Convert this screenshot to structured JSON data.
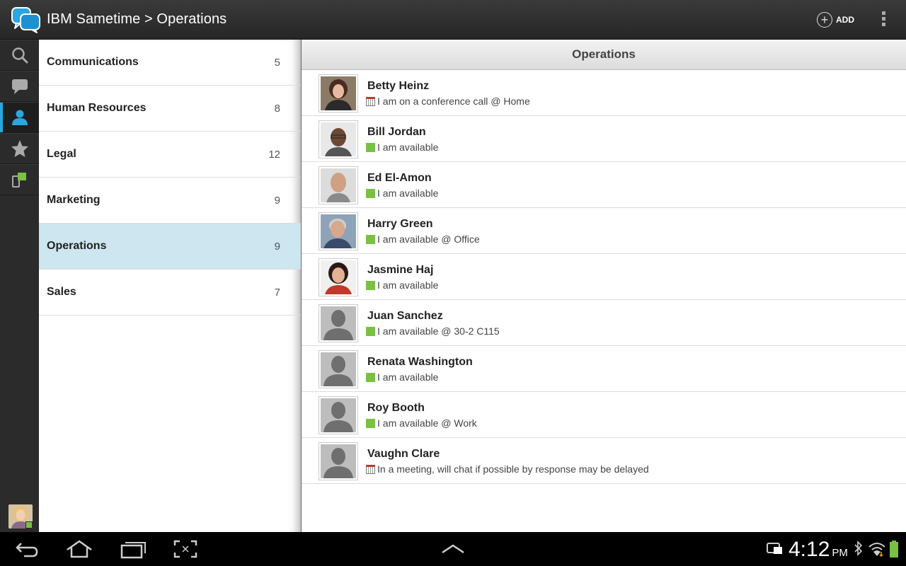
{
  "header": {
    "title": "IBM Sametime > Operations",
    "add_label": "ADD"
  },
  "rail": {
    "items": [
      "search-icon",
      "chat-icon",
      "contacts-icon",
      "favorites-icon",
      "devices-icon"
    ],
    "active": "contacts-icon",
    "accent": "#29a7e0"
  },
  "groups": [
    {
      "name": "Communications",
      "count": "5"
    },
    {
      "name": "Human Resources",
      "count": "8"
    },
    {
      "name": "Legal",
      "count": "12"
    },
    {
      "name": "Marketing",
      "count": "9"
    },
    {
      "name": "Operations",
      "count": "9",
      "selected": true
    },
    {
      "name": "Sales",
      "count": "7"
    }
  ],
  "detail": {
    "title": "Operations",
    "contacts": [
      {
        "name": "Betty Heinz",
        "status": "I am on a conference call @ Home",
        "state": "meeting",
        "photo": "woman-dark-hair"
      },
      {
        "name": "Bill Jordan",
        "status": "I am available",
        "state": "available",
        "photo": "man-glasses"
      },
      {
        "name": "Ed El-Amon",
        "status": "I am available",
        "state": "available",
        "photo": "man-bald"
      },
      {
        "name": "Harry Green",
        "status": "I am available @ Office",
        "state": "available",
        "photo": "man-grey-hair"
      },
      {
        "name": "Jasmine Haj",
        "status": "I am available",
        "state": "available",
        "photo": "woman-smiling"
      },
      {
        "name": "Juan Sanchez",
        "status": "I am available @ 30-2 C115",
        "state": "available",
        "photo": "placeholder"
      },
      {
        "name": "Renata Washington",
        "status": "I am available",
        "state": "available",
        "photo": "placeholder"
      },
      {
        "name": "Roy Booth",
        "status": "I am available @ Work",
        "state": "available",
        "photo": "placeholder"
      },
      {
        "name": "Vaughn Clare",
        "status": "In a meeting, will chat if possible by response may be delayed",
        "state": "meeting",
        "photo": "placeholder"
      }
    ]
  },
  "status_colors": {
    "available": "#7ac043",
    "meeting": "#c0392b"
  },
  "system": {
    "time": "4:12",
    "ampm": "PM"
  }
}
